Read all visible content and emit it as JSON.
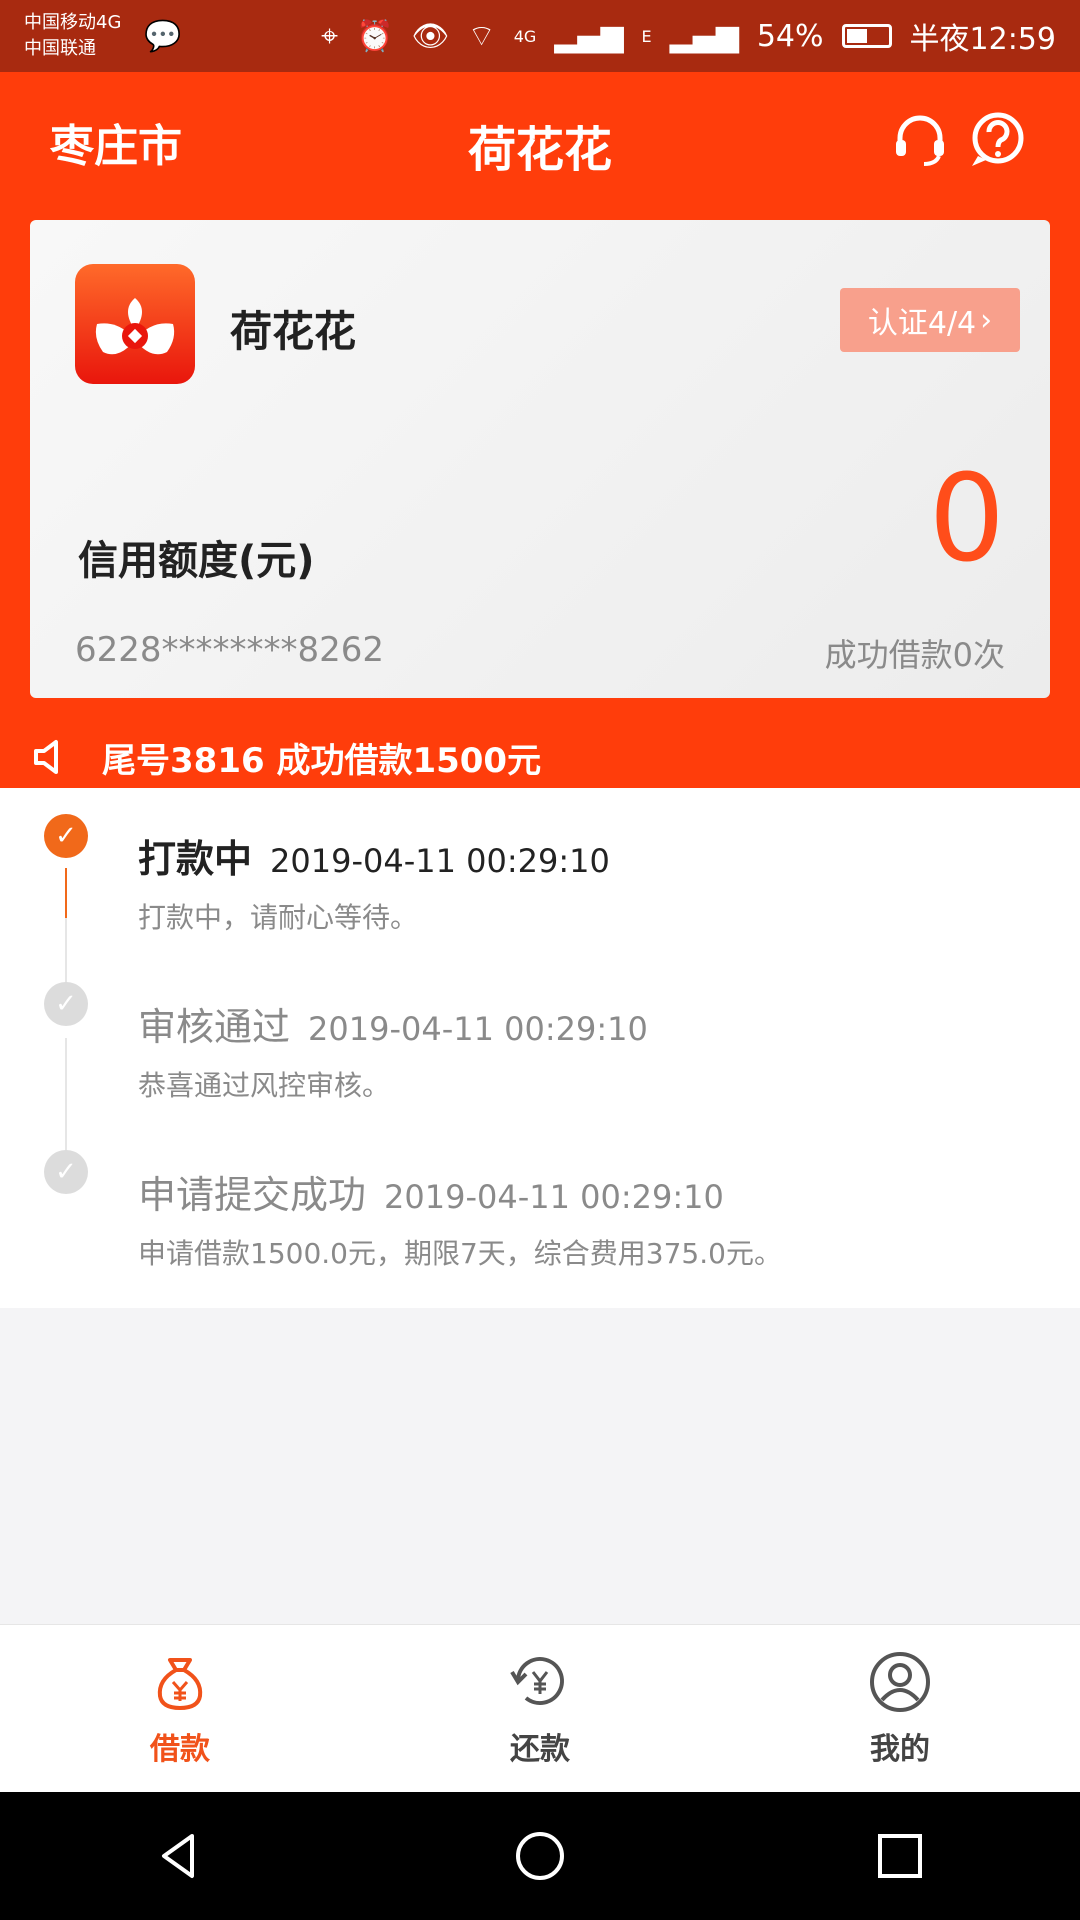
{
  "status_bar": {
    "carrier_line1": "中国移动4G",
    "carrier_line2": "中国联通",
    "signal_4g": "4G",
    "signal_e": "E",
    "battery": "54%",
    "time_label": "半夜12:59"
  },
  "header": {
    "city": "枣庄市",
    "title": "荷花花",
    "notice": "尾号3816 成功借款1500元"
  },
  "card": {
    "app_name": "荷花花",
    "cert_button": "认证4/4",
    "credit_label": "信用额度(元)",
    "credit_amount": "0",
    "card_number": "6228********8262",
    "success_count": "成功借款0次"
  },
  "timeline": [
    {
      "title": "打款中",
      "time": "2019-04-11 00:29:10",
      "desc": "打款中，请耐心等待。"
    },
    {
      "title": "审核通过",
      "time": "2019-04-11 00:29:10",
      "desc": "恭喜通过风控审核。"
    },
    {
      "title": "申请提交成功",
      "time": "2019-04-11 00:29:10",
      "desc": "申请借款1500.0元，期限7天，综合费用375.0元。"
    }
  ],
  "tabs": [
    {
      "label": "借款"
    },
    {
      "label": "还款"
    },
    {
      "label": "我的"
    }
  ],
  "colors": {
    "brand": "#ff3d0b",
    "accent": "#f1691a",
    "status_bar": "#a82a10"
  }
}
